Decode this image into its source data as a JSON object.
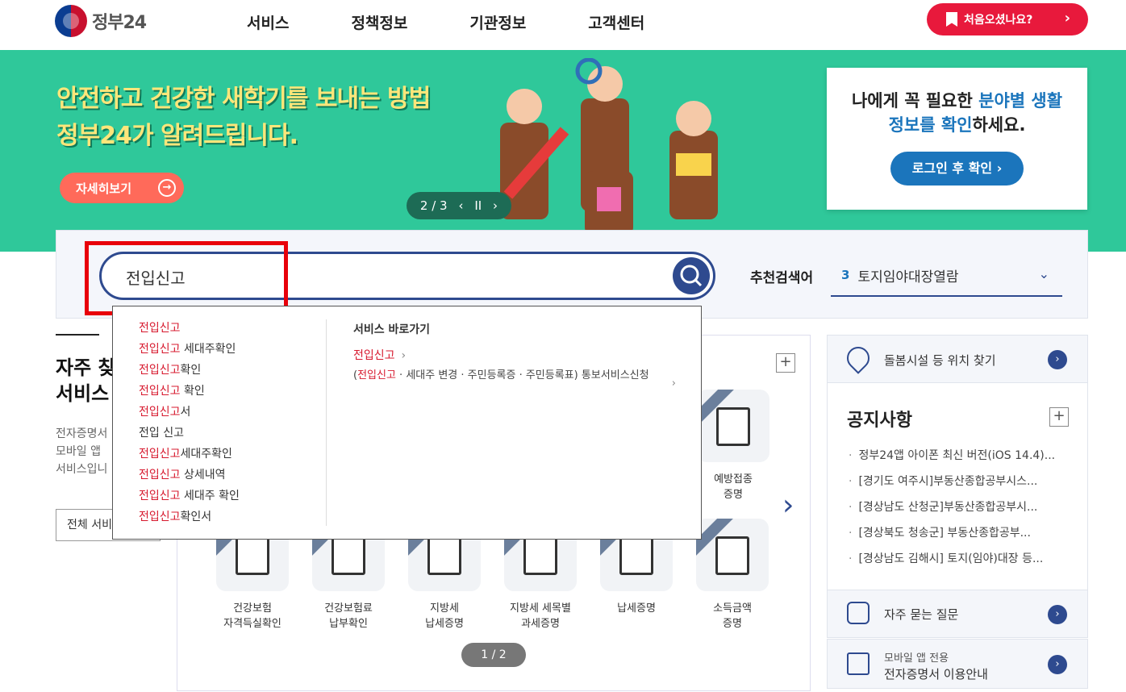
{
  "header": {
    "logo_text": "정부24",
    "nav": [
      "서비스",
      "정책정보",
      "기관정보",
      "고객센터"
    ],
    "first_visit_label": "처음오셨나요?",
    "first_visit_chevron": "›"
  },
  "banner": {
    "title_line1": "안전하고 건강한 새학기를 보내는 방법",
    "title_line2": "정부24가 알려드립니다.",
    "detail_label": "자세히보기",
    "slide_indicator": "2 / 3",
    "prev": "‹",
    "pause": "II",
    "next": "›",
    "bg_color": "#2fc89a"
  },
  "login": {
    "msg_prefix": "나에게 꼭 필요한 ",
    "msg_highlight1": "분야별 생활",
    "msg_highlight2": "정보를 확인",
    "msg_suffix": "하세요.",
    "button_label": "로그인 후 확인 ›"
  },
  "search": {
    "value": "전입신고",
    "recommend_label": "추천검색어",
    "recommend_num": "3",
    "recommend_text": "토지임야대장열람",
    "recommend_chevron": "⌄"
  },
  "dropdown": {
    "suggestions": [
      {
        "kw": "전입신고",
        "rest": ""
      },
      {
        "kw": "전입신고",
        "rest": " 세대주확인"
      },
      {
        "kw": "전입신고",
        "rest": "확인"
      },
      {
        "kw": "전입신고",
        "rest": " 확인"
      },
      {
        "kw": "전입신고",
        "rest": "서"
      },
      {
        "kw": "",
        "rest": "전입 신고"
      },
      {
        "kw": "전입신고",
        "rest": "세대주확인"
      },
      {
        "kw": "전입신고",
        "rest": " 상세내역"
      },
      {
        "kw": "전입신고",
        "rest": " 세대주 확인"
      },
      {
        "kw": "전입신고",
        "rest": "확인서"
      }
    ],
    "service_title": "서비스 바로가기",
    "service1": "전입신고",
    "service2_open": "(",
    "service2_kw": "전입신고",
    "service2_rest": " · 세대주 변경 · 주민등록증 · 주민등록표) 통보서비스신청",
    "chevron": "›"
  },
  "left": {
    "title_line1": "자주 찾",
    "title_line2": "서비스",
    "desc_line1": "전자증명서",
    "desc_line2": "모바일 앱",
    "desc_line3": "서비스입니",
    "all_button": "전체 서비"
  },
  "services": {
    "plus": "+",
    "row1_last": {
      "line1": "예방접종",
      "line2": "증명"
    },
    "row2": [
      {
        "line1": "건강보험",
        "line2": "자격득실확인"
      },
      {
        "line1": "건강보험료",
        "line2": "납부확인"
      },
      {
        "line1": "지방세",
        "line2": "납세증명"
      },
      {
        "line1": "지방세 세목별",
        "line2": "과세증명"
      },
      {
        "line1": "납세증명",
        "line2": ""
      },
      {
        "line1": "소득금액",
        "line2": "증명"
      }
    ],
    "pager": "1 / 2",
    "next_arrow": "›"
  },
  "right": {
    "care_label": "돌봄시설 등 위치 찾기",
    "go": "›",
    "notice_title": "공지사항",
    "notice_plus": "+",
    "notices": [
      "정부24앱 아이폰 최신 버전(iOS 14.4)...",
      "[경기도 여주시]부동산종합공부시스...",
      "[경상남도 산청군]부동산종합공부시...",
      "[경상북도 청송군] 부동산종합공부...",
      "[경상남도 김해시] 토지(임야)대장 등..."
    ],
    "faq_label": "자주 묻는 질문",
    "mobile_line1": "모바일 앱 전용",
    "mobile_line2": "전자증명서 이용안내"
  }
}
